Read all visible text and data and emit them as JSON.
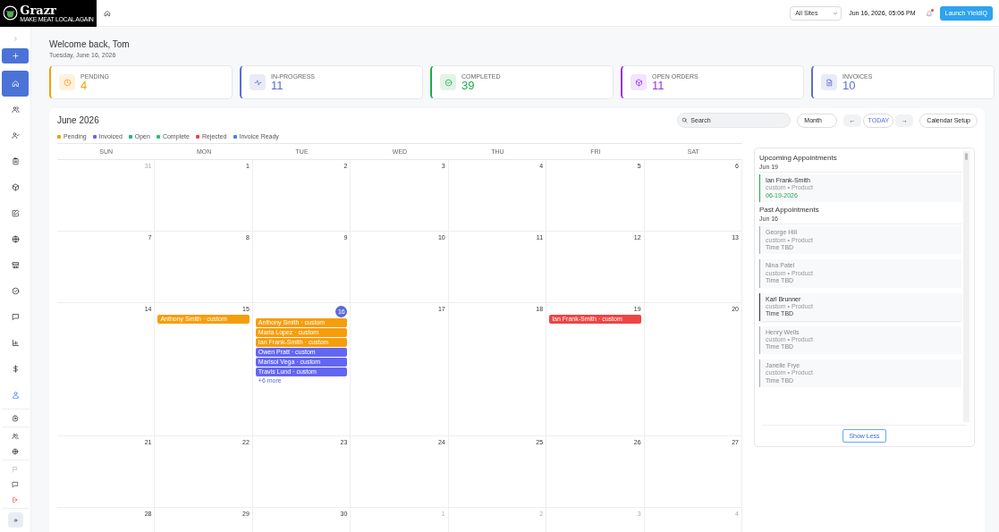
{
  "logo": {
    "name": "Grazr",
    "tagline": "MAKE MEAT LOCAL AGAIN"
  },
  "topbar": {
    "site_select": "All Sites",
    "datetime": "Jun 16, 2026, 05:06 PM",
    "notification_dot": true,
    "launch_button": "Launch YieldIQ"
  },
  "sidebar": {
    "items": [
      {
        "kind": "toggle"
      },
      {
        "kind": "add"
      },
      {
        "kind": "nav",
        "selected": true,
        "highlighted": false
      },
      {
        "kind": "nav",
        "selected": false,
        "highlighted": false
      },
      {
        "kind": "nav",
        "selected": false,
        "highlighted": false
      },
      {
        "kind": "nav",
        "selected": false,
        "highlighted": false
      },
      {
        "kind": "nav",
        "selected": false,
        "highlighted": false
      },
      {
        "kind": "nav",
        "selected": false,
        "highlighted": false
      },
      {
        "kind": "nav",
        "selected": false,
        "highlighted": false
      },
      {
        "kind": "nav",
        "selected": false,
        "highlighted": false
      },
      {
        "kind": "nav",
        "selected": false,
        "highlighted": false
      },
      {
        "kind": "nav",
        "selected": false,
        "highlighted": false
      },
      {
        "kind": "nav",
        "selected": false,
        "highlighted": false
      },
      {
        "kind": "nav",
        "selected": false,
        "highlighted": false
      },
      {
        "kind": "nav",
        "selected": false,
        "highlighted": true
      },
      {
        "kind": "divider"
      },
      {
        "kind": "small",
        "disabled": false
      },
      {
        "kind": "divider"
      },
      {
        "kind": "small",
        "disabled": false
      },
      {
        "kind": "small",
        "disabled": false
      },
      {
        "kind": "divider"
      },
      {
        "kind": "small",
        "disabled": true
      },
      {
        "kind": "small",
        "disabled": false
      },
      {
        "kind": "logout"
      },
      {
        "kind": "divider"
      },
      {
        "kind": "avatar"
      }
    ]
  },
  "welcome": {
    "title": "Welcome back, Tom",
    "date": "Tuesday, June 16, 2026"
  },
  "stats": [
    {
      "label": "PENDING",
      "value": "4",
      "color": "#f59e0b"
    },
    {
      "label": "IN-PROGRESS",
      "value": "11",
      "color": "#5b6bd5"
    },
    {
      "label": "COMPLETED",
      "value": "39",
      "color": "#22a84a"
    },
    {
      "label": "OPEN ORDERS",
      "value": "11",
      "color": "#9333ea"
    },
    {
      "label": "INVOICES",
      "value": "10",
      "color": "#5b6bd5"
    }
  ],
  "calendar": {
    "title": "June 2026",
    "search_placeholder": "Search",
    "view_select": "Month",
    "prev_button": "←",
    "today_button": "TODAY",
    "next_button": "→",
    "setup_button": "Calendar Setup",
    "legend": [
      {
        "label": "Pending",
        "color": "#f59e0b"
      },
      {
        "label": "Invoiced",
        "color": "#6366f1"
      },
      {
        "label": "Open",
        "color": "#10b981"
      },
      {
        "label": "Complete",
        "color": "#22c55e"
      },
      {
        "label": "Rejected",
        "color": "#ef4444"
      },
      {
        "label": "Invoice Ready",
        "color": "#3b82f6"
      }
    ],
    "weekdays": [
      "SUN",
      "MON",
      "TUE",
      "WED",
      "THU",
      "FRI",
      "SAT"
    ],
    "weeks": [
      [
        {
          "number": "31",
          "outside": true,
          "today": false
        },
        {
          "number": "1",
          "outside": false,
          "today": false
        },
        {
          "number": "2",
          "outside": false,
          "today": false
        },
        {
          "number": "3",
          "outside": false,
          "today": false
        },
        {
          "number": "4",
          "outside": false,
          "today": false
        },
        {
          "number": "5",
          "outside": false,
          "today": false
        },
        {
          "number": "6",
          "outside": false,
          "today": false
        }
      ],
      [
        {
          "number": "7",
          "outside": false,
          "today": false
        },
        {
          "number": "8",
          "outside": false,
          "today": false
        },
        {
          "number": "9",
          "outside": false,
          "today": false
        },
        {
          "number": "10",
          "outside": false,
          "today": false
        },
        {
          "number": "11",
          "outside": false,
          "today": false
        },
        {
          "number": "12",
          "outside": false,
          "today": false
        },
        {
          "number": "13",
          "outside": false,
          "today": false
        }
      ],
      [
        {
          "number": "14",
          "outside": false,
          "today": false
        },
        {
          "number": "15",
          "outside": false,
          "today": false,
          "events": [
            {
              "title": "Anthony Smith · custom",
              "color": "#f59e0b"
            }
          ]
        },
        {
          "number": "16",
          "outside": false,
          "today": true,
          "events": [
            {
              "title": "Anthony Smith · custom",
              "color": "#f59e0b"
            },
            {
              "title": "Maria Lopez · custom",
              "color": "#f59e0b"
            },
            {
              "title": "Ian Frank-Smith · custom",
              "color": "#f59e0b"
            },
            {
              "title": "Owen Pratt · custom",
              "color": "#6366f1"
            },
            {
              "title": "Marisol Vega · custom",
              "color": "#6366f1"
            },
            {
              "title": "Travis Lund · custom",
              "color": "#6366f1"
            }
          ],
          "more": "+6 more"
        },
        {
          "number": "17",
          "outside": false,
          "today": false
        },
        {
          "number": "18",
          "outside": false,
          "today": false
        },
        {
          "number": "19",
          "outside": false,
          "today": false,
          "events": [
            {
              "title": "Ian Frank-Smith · custom",
              "color": "#ef4444"
            }
          ]
        },
        {
          "number": "20",
          "outside": false,
          "today": false
        }
      ],
      [
        {
          "number": "21",
          "outside": false,
          "today": false
        },
        {
          "number": "22",
          "outside": false,
          "today": false
        },
        {
          "number": "23",
          "outside": false,
          "today": false
        },
        {
          "number": "24",
          "outside": false,
          "today": false
        },
        {
          "number": "25",
          "outside": false,
          "today": false
        },
        {
          "number": "26",
          "outside": false,
          "today": false
        },
        {
          "number": "27",
          "outside": false,
          "today": false
        }
      ],
      [
        {
          "number": "28",
          "outside": false,
          "today": false
        },
        {
          "number": "29",
          "outside": false,
          "today": false
        },
        {
          "number": "30",
          "outside": false,
          "today": false
        },
        {
          "number": "1",
          "outside": true,
          "today": false
        },
        {
          "number": "2",
          "outside": true,
          "today": false
        },
        {
          "number": "3",
          "outside": true,
          "today": false
        },
        {
          "number": "4",
          "outside": true,
          "today": false
        }
      ]
    ]
  },
  "appointments": {
    "sections": [
      {
        "title": "Upcoming Appointments",
        "date": "Jun 19",
        "past": false,
        "items": [
          {
            "name": "Ian Frank-Smith",
            "detail": "custom • Product",
            "time": "06-19-2026",
            "selected": false
          }
        ]
      },
      {
        "title": "Past Appointments",
        "date": "Jun 16",
        "past": true,
        "items": [
          {
            "name": "George Hill",
            "detail": "custom • Product",
            "time": "Time TBD",
            "selected": false
          },
          {
            "name": "Nina Patel",
            "detail": "custom • Product",
            "time": "Time TBD",
            "selected": false
          },
          {
            "name": "Karl Brunner",
            "detail": "custom • Product",
            "time": "Time TBD",
            "selected": true
          },
          {
            "name": "Henry Wells",
            "detail": "custom • Product",
            "time": "Time TBD",
            "selected": false
          },
          {
            "name": "Janelle Frye",
            "detail": "custom • Product",
            "time": "Time TBD",
            "selected": false
          }
        ]
      }
    ],
    "show_less_button": "Show Less"
  }
}
